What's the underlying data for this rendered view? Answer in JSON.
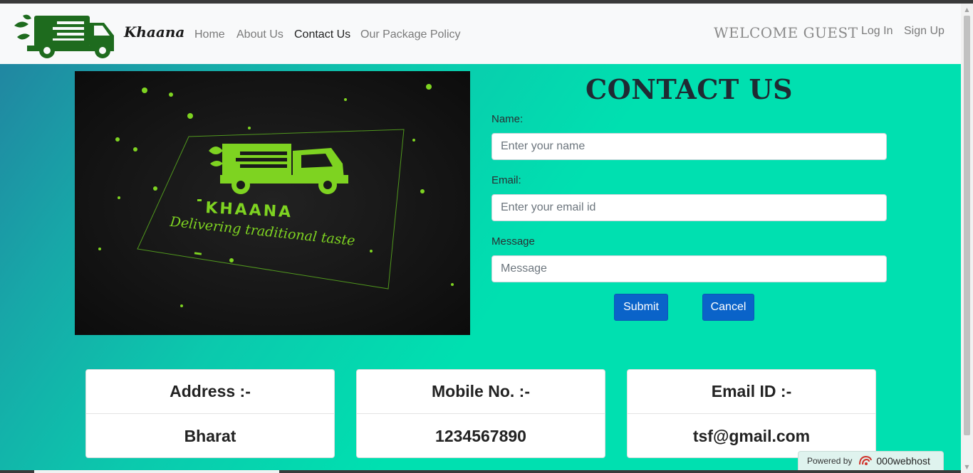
{
  "navbar": {
    "brand": "Khaana",
    "links": [
      {
        "label": "Home"
      },
      {
        "label": "About Us"
      },
      {
        "label": "Contact Us"
      },
      {
        "label": "Our Package Policy"
      }
    ],
    "welcome": "WELCOME GUEST",
    "login": "Log In",
    "signup": "Sign Up",
    "logo_icon": "delivery-truck-icon"
  },
  "hero": {
    "brand_text": "KHAANA",
    "tagline": "Delivering traditional taste",
    "colors": {
      "background": "#141414",
      "accent": "#7ed321"
    }
  },
  "contact": {
    "title": "CONTACT US",
    "name_label": "Name:",
    "name_placeholder": "Enter your name",
    "email_label": "Email:",
    "email_placeholder": "Enter your email id",
    "message_label": "Message",
    "message_placeholder": "Message",
    "submit": "Submit",
    "cancel": "Cancel"
  },
  "cards": [
    {
      "title": "Address :-",
      "value": "Bharat"
    },
    {
      "title": "Mobile No. :-",
      "value": "1234567890"
    },
    {
      "title": "Email ID :-",
      "value": "tsf@gmail.com"
    }
  ],
  "footer_badge": {
    "prefix": "Powered by",
    "host": "000webhost",
    "icon": "000webhost-logo-icon"
  },
  "colors": {
    "gradient_start": "#237fa0",
    "gradient_end": "#00e0b0",
    "button": "#0a63c9",
    "logo_green": "#1e6b1e"
  }
}
